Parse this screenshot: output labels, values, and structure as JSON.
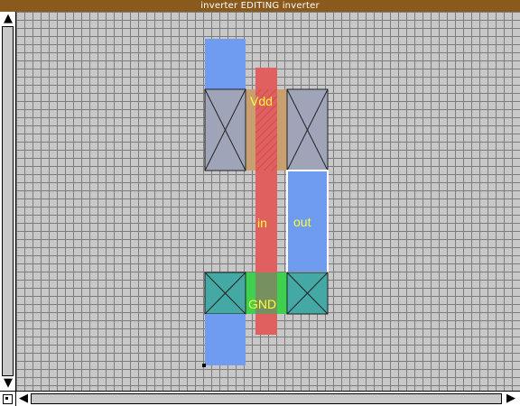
{
  "window": {
    "title": "inverter EDITING inverter"
  },
  "scrollbars": {
    "up_arrow": "▲",
    "down_arrow": "▼",
    "left_arrow": "◀",
    "right_arrow": "▶"
  },
  "labels": {
    "vdd": "Vdd",
    "gnd": "GND",
    "in": "in",
    "out": "out"
  },
  "colors": {
    "metal": "#6f9bf0",
    "poly": "#e06060",
    "pdiff": "#c8a070",
    "ndiff": "#3fd04f",
    "contact_pmos": "#a0a4b8",
    "contact_nmos": "#44a8a4",
    "label_text": "#ffff33",
    "title_bar": "#8a5a1c"
  }
}
